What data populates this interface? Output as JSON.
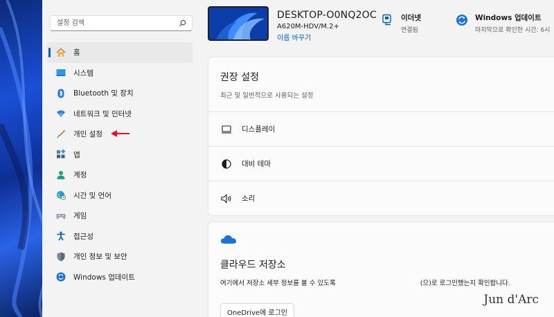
{
  "search": {
    "placeholder": "설정 검색",
    "icon": "search-icon"
  },
  "sidebar": {
    "items": [
      {
        "label": "홈",
        "icon": "home-icon",
        "active": true
      },
      {
        "label": "시스템",
        "icon": "system-icon"
      },
      {
        "label": "Bluetooth 및 장치",
        "icon": "bluetooth-icon"
      },
      {
        "label": "네트워크 및 인터넷",
        "icon": "wifi-icon"
      },
      {
        "label": "개인 설정",
        "icon": "paintbrush-icon"
      },
      {
        "label": "앱",
        "icon": "apps-icon"
      },
      {
        "label": "계정",
        "icon": "account-icon"
      },
      {
        "label": "시간 및 언어",
        "icon": "globe-clock-icon"
      },
      {
        "label": "게임",
        "icon": "gamepad-icon"
      },
      {
        "label": "접근성",
        "icon": "accessibility-icon"
      },
      {
        "label": "개인 정보 및 보안",
        "icon": "shield-icon"
      },
      {
        "label": "Windows 업데이트",
        "icon": "update-icon"
      }
    ]
  },
  "device": {
    "name": "DESKTOP-O0NQ2OC",
    "model": "A620M-HDV/M.2+",
    "rename": "이름 바꾸기"
  },
  "status": {
    "internet": {
      "title": "이더넷",
      "sub": "연결됨"
    },
    "update": {
      "title": "Windows 업데이트",
      "sub": "마지막으로 확인한 시간: 6시"
    }
  },
  "recommended": {
    "title": "권장 설정",
    "subtitle": "최근 및 일반적으로 사용되는 설정",
    "rows": [
      {
        "label": "디스플레이",
        "icon": "monitor-icon"
      },
      {
        "label": "대비 테마",
        "icon": "contrast-icon"
      },
      {
        "label": "소리",
        "icon": "speaker-icon"
      }
    ]
  },
  "cloud": {
    "title": "클라우드 저장소",
    "desc_before": "여기에서 저장소 세부 정보를 볼 수 있도록",
    "desc_after": "(으)로 로그인했는지 확인합니다.",
    "button": "OneDrive에 로그인"
  },
  "watermark": "Jun d'Arc",
  "colors": {
    "accent": "#005fb8",
    "arrow": "#e81123"
  }
}
